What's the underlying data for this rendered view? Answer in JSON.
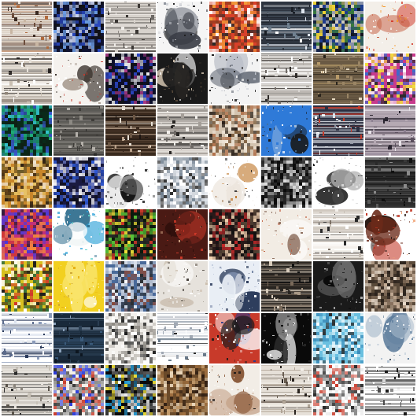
{
  "grid": {
    "rows": 8,
    "cols": 8,
    "background": "#ffffff",
    "tiles": [
      {
        "palette": [
          "#e9e2da",
          "#6b4c3b",
          "#c8b6a3",
          "#3a2a22",
          "#b06a3c"
        ],
        "style": "stripes"
      },
      {
        "palette": [
          "#0f1230",
          "#2b4cc8",
          "#6fa0e8",
          "#111111",
          "#c9d3ef"
        ],
        "style": "noise"
      },
      {
        "palette": [
          "#d7d2cc",
          "#8f8a85",
          "#3b3734",
          "#f0ede9",
          "#6e6a66"
        ],
        "style": "stripes"
      },
      {
        "palette": [
          "#f5f5f5",
          "#1d1d1d",
          "#8a8f99",
          "#c3c6cc",
          "#3a3e46"
        ],
        "style": "blob"
      },
      {
        "palette": [
          "#d8412a",
          "#f4a23a",
          "#2a2a2a",
          "#ffffff",
          "#8b3b1f"
        ],
        "style": "noise"
      },
      {
        "palette": [
          "#2e3540",
          "#dfe5ee",
          "#ffffff",
          "#70808f",
          "#1a1f26"
        ],
        "style": "stripes"
      },
      {
        "palette": [
          "#1f3c8c",
          "#f1d330",
          "#3a7a3a",
          "#111111",
          "#d9d2c0"
        ],
        "style": "noise"
      },
      {
        "palette": [
          "#f3efe9",
          "#d23b2a",
          "#f39a2c",
          "#ffffff",
          "#c45a3c"
        ],
        "style": "blob"
      },
      {
        "palette": [
          "#e8e2da",
          "#2a2624",
          "#8f8478",
          "#c9bfb2",
          "#ffffff"
        ],
        "style": "stripes"
      },
      {
        "palette": [
          "#f5f2ee",
          "#c23a2e",
          "#9b8d80",
          "#ffffff",
          "#3d3530"
        ],
        "style": "blob"
      },
      {
        "palette": [
          "#0d0f2a",
          "#2f4bd1",
          "#b23c8a",
          "#e9e9e9",
          "#111111"
        ],
        "style": "noise"
      },
      {
        "palette": [
          "#1a1a1a",
          "#ffffff",
          "#c7b9a6",
          "#5a4a3a",
          "#2e2a26"
        ],
        "style": "blob"
      },
      {
        "palette": [
          "#f3f3f3",
          "#121212",
          "#5d6470",
          "#b9bec7",
          "#2a2a2a"
        ],
        "style": "blob"
      },
      {
        "palette": [
          "#d9d6d2",
          "#ffffff",
          "#6f6a65",
          "#b0aba5",
          "#2f2c29"
        ],
        "style": "stripes"
      },
      {
        "palette": [
          "#6a5a44",
          "#b89b6a",
          "#e6d9c0",
          "#2a241c",
          "#9a8565"
        ],
        "style": "stripes"
      },
      {
        "palette": [
          "#c83a8c",
          "#f2e13a",
          "#2a2a2a",
          "#3a6acb",
          "#ffffff"
        ],
        "style": "noise"
      },
      {
        "palette": [
          "#0a2a1a",
          "#1fae7a",
          "#36c9d3",
          "#3b5ad4",
          "#0f1f14"
        ],
        "style": "noise"
      },
      {
        "palette": [
          "#5c5a56",
          "#8c8983",
          "#2b2a28",
          "#b4b0aa",
          "#3e3c39"
        ],
        "style": "stripes"
      },
      {
        "palette": [
          "#3a2a1e",
          "#b8a089",
          "#e9e1d6",
          "#6b5644",
          "#1d1612"
        ],
        "style": "stripes"
      },
      {
        "palette": [
          "#d9d4cf",
          "#f1eeea",
          "#6d6864",
          "#2a2725",
          "#a49e98"
        ],
        "style": "stripes"
      },
      {
        "palette": [
          "#d3c4b0",
          "#7a5a3a",
          "#f0e6d8",
          "#2a2018",
          "#b0704a"
        ],
        "style": "noise"
      },
      {
        "palette": [
          "#2f7ad8",
          "#ffffff",
          "#4a6a8a",
          "#d0d8e0",
          "#1a1a1a"
        ],
        "style": "blob"
      },
      {
        "palette": [
          "#2b2f40",
          "#dfe3ea",
          "#8a909e",
          "#ffffff",
          "#c33a2a"
        ],
        "style": "stripes"
      },
      {
        "palette": [
          "#b5a9b3",
          "#5b4f5e",
          "#e7e2e8",
          "#2a2530",
          "#8c7f90"
        ],
        "style": "stripes"
      },
      {
        "palette": [
          "#c8862a",
          "#2a1e12",
          "#f0e6d4",
          "#6a5a2a",
          "#e9c76a"
        ],
        "style": "noise"
      },
      {
        "palette": [
          "#1a1a40",
          "#2e5ad8",
          "#ffffff",
          "#0f0f1a",
          "#7a8ad8"
        ],
        "style": "noise"
      },
      {
        "palette": [
          "#ffffff",
          "#121212",
          "#8a8a8a",
          "#e6e6e6",
          "#3a3a3a"
        ],
        "style": "blob"
      },
      {
        "palette": [
          "#ffffff",
          "#6a7a8a",
          "#2a2a2a",
          "#d9dee5",
          "#a9b2bd"
        ],
        "style": "noise"
      },
      {
        "palette": [
          "#ffffff",
          "#c07a30",
          "#2a2a2a",
          "#e9e2d8",
          "#8c5a2a"
        ],
        "style": "blob"
      },
      {
        "palette": [
          "#0d0d0d",
          "#2a2a2a",
          "#d9d9d9",
          "#5a5a5a",
          "#f2f2f2"
        ],
        "style": "noise"
      },
      {
        "palette": [
          "#ffffff",
          "#1a1a1a",
          "#b0b0b0",
          "#4a4a4a",
          "#e0e0e0"
        ],
        "style": "blob"
      },
      {
        "palette": [
          "#2a2a2a",
          "#5a5a5a",
          "#111111",
          "#8a8a8a",
          "#3a3a3a"
        ],
        "style": "stripes"
      },
      {
        "palette": [
          "#c0307a",
          "#d33a2a",
          "#4a3ad8",
          "#2a1a3a",
          "#f28a3a"
        ],
        "style": "noise"
      },
      {
        "palette": [
          "#ffffff",
          "#2aa0d8",
          "#5ad0c8",
          "#e8f0f0",
          "#2a6a8a"
        ],
        "style": "blob"
      },
      {
        "palette": [
          "#0d1a0d",
          "#5ac83a",
          "#f2e23a",
          "#d33a2a",
          "#2a2a2a"
        ],
        "style": "noise"
      },
      {
        "palette": [
          "#4a1a14",
          "#d33a2a",
          "#2a0e0a",
          "#f2c8a0",
          "#7a2a1e"
        ],
        "style": "blob"
      },
      {
        "palette": [
          "#2a1a1a",
          "#c02a2a",
          "#f2d2b0",
          "#5a4a3a",
          "#111111"
        ],
        "style": "noise"
      },
      {
        "palette": [
          "#f2ece4",
          "#c05a3a",
          "#ffffff",
          "#8a6a5a",
          "#d8b090"
        ],
        "style": "blob"
      },
      {
        "palette": [
          "#f3efea",
          "#2a2a2a",
          "#c8c0b6",
          "#7a6f64",
          "#ffffff"
        ],
        "style": "stripes"
      },
      {
        "palette": [
          "#ffffff",
          "#c0301e",
          "#2a1a14",
          "#f0a070",
          "#6a2a1a"
        ],
        "style": "blob"
      },
      {
        "palette": [
          "#d8c020",
          "#2a6a3a",
          "#ffffff",
          "#1a1a1a",
          "#d0332a"
        ],
        "style": "noise"
      },
      {
        "palette": [
          "#f2d020",
          "#e6b010",
          "#ffffff",
          "#c8a030",
          "#f9e36a"
        ],
        "style": "blob"
      },
      {
        "palette": [
          "#4a6a9a",
          "#ffffff",
          "#2a2a2a",
          "#c0c8d6",
          "#8a4a3a"
        ],
        "style": "noise"
      },
      {
        "palette": [
          "#e6e2dc",
          "#ffffff",
          "#8a8278",
          "#3a342e",
          "#c7b9a8"
        ],
        "style": "blob"
      },
      {
        "palette": [
          "#e9eef5",
          "#2a3a5a",
          "#ffffff",
          "#7a8aa8",
          "#c0cadc"
        ],
        "style": "blob"
      },
      {
        "palette": [
          "#2a2622",
          "#7a6a5a",
          "#d8ccbc",
          "#111111",
          "#a89886"
        ],
        "style": "stripes"
      },
      {
        "palette": [
          "#1a1a1a",
          "#6a6a6a",
          "#c8c8c8",
          "#0a0a0a",
          "#3a3a3a"
        ],
        "style": "blob"
      },
      {
        "palette": [
          "#5a4a3a",
          "#c8b09a",
          "#2a221c",
          "#8a7460",
          "#e6d8c8"
        ],
        "style": "noise"
      },
      {
        "palette": [
          "#ffffff",
          "#2a3a5a",
          "#8a9ab8",
          "#dde3ee",
          "#5a6a8a"
        ],
        "style": "stripes"
      },
      {
        "palette": [
          "#1a2a3a",
          "#3a5a7a",
          "#0d1620",
          "#8aa0b8",
          "#2a3e52"
        ],
        "style": "stripes"
      },
      {
        "palette": [
          "#f2f0ec",
          "#1a1a1a",
          "#8a8680",
          "#ffffff",
          "#c0bcb6"
        ],
        "style": "noise"
      },
      {
        "palette": [
          "#ffffff",
          "#2a2a2a",
          "#6a7a8a",
          "#e6e9ee",
          "#a0a8b3"
        ],
        "style": "stripes"
      },
      {
        "palette": [
          "#c83a2a",
          "#ffffff",
          "#2a3a8a",
          "#f0a080",
          "#1a1a1a"
        ],
        "style": "blob"
      },
      {
        "palette": [
          "#0a0a0a",
          "#ffffff",
          "#2a2a2a",
          "#d0d0d0",
          "#5a5a5a"
        ],
        "style": "blob"
      },
      {
        "palette": [
          "#6ac0e0",
          "#ffffff",
          "#3a8ab8",
          "#c0e6f2",
          "#2a2a2a"
        ],
        "style": "noise"
      },
      {
        "palette": [
          "#f2f2f2",
          "#5a7a9a",
          "#ffffff",
          "#b0c0d0",
          "#2a3a4a"
        ],
        "style": "blob"
      },
      {
        "palette": [
          "#e6e2dc",
          "#2a2a2a",
          "#8a847c",
          "#c8c2b8",
          "#5a544c"
        ],
        "style": "stripes"
      },
      {
        "palette": [
          "#f2efe9",
          "#2a3ad8",
          "#c83a2a",
          "#1a1a1a",
          "#8a8a8a"
        ],
        "style": "noise"
      },
      {
        "palette": [
          "#0a0a0a",
          "#2aa0d8",
          "#f2e23a",
          "#ffffff",
          "#5a5a5a"
        ],
        "style": "noise"
      },
      {
        "palette": [
          "#6a4a2a",
          "#c8a070",
          "#2a1a10",
          "#f0dcc0",
          "#a07040"
        ],
        "style": "noise"
      },
      {
        "palette": [
          "#f2ede6",
          "#1a1a1a",
          "#8a5a3a",
          "#ffffff",
          "#c8a890"
        ],
        "style": "blob"
      },
      {
        "palette": [
          "#e6e0d8",
          "#2a2420",
          "#b0a496",
          "#6a5e52",
          "#f6f2ec"
        ],
        "style": "stripes"
      },
      {
        "palette": [
          "#ffffff",
          "#2a2a2a",
          "#c83a2a",
          "#e6e6e6",
          "#6a6a6a"
        ],
        "style": "noise"
      },
      {
        "palette": [
          "#ffffff",
          "#1a1a1a",
          "#8a8a8a",
          "#d8d8d8",
          "#4a4a4a"
        ],
        "style": "stripes"
      }
    ]
  }
}
